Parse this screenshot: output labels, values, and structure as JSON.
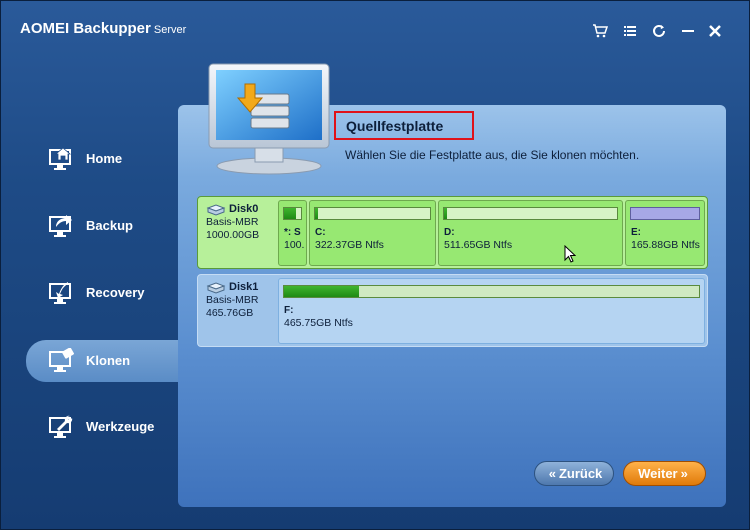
{
  "app": {
    "title": "AOMEI Backupper",
    "edition": "Server",
    "window_buttons": [
      "cart-icon",
      "menu-icon",
      "refresh-icon",
      "minimize-icon",
      "close-icon"
    ]
  },
  "sidebar": {
    "items": [
      {
        "label": "Home",
        "icon": "home-icon",
        "active": false
      },
      {
        "label": "Backup",
        "icon": "backup-icon",
        "active": false
      },
      {
        "label": "Recovery",
        "icon": "recovery-icon",
        "active": false
      },
      {
        "label": "Klonen",
        "icon": "clone-icon",
        "active": true
      },
      {
        "label": "Werkzeuge",
        "icon": "tools-icon",
        "active": false
      }
    ]
  },
  "main": {
    "title": "Quellfestplatte",
    "description": "Wählen Sie die Festplatte aus, die Sie klonen möchten."
  },
  "disks": [
    {
      "name": "Disk0",
      "type": "Basis-MBR",
      "size": "1000.00GB",
      "selected": true,
      "partitions": [
        {
          "letter": "*: S",
          "info": "100.",
          "used": 0.7
        },
        {
          "letter": "C:",
          "info": "322.37GB Ntfs",
          "used": 0.03
        },
        {
          "letter": "D:",
          "info": "511.65GB Ntfs",
          "used": 0.02
        },
        {
          "letter": "E:",
          "info": "165.88GB Ntfs",
          "used": 1.0
        }
      ]
    },
    {
      "name": "Disk1",
      "type": "Basis-MBR",
      "size": "465.76GB",
      "selected": false,
      "partitions": [
        {
          "letter": "F:",
          "info": "465.75GB Ntfs",
          "used": 0.18
        }
      ]
    }
  ],
  "buttons": {
    "back": "Zurück",
    "next": "Weiter"
  },
  "colors": {
    "accent_red": "#e0121a",
    "selected_green": "#b7f09a",
    "next_orange": "#f09a26"
  }
}
